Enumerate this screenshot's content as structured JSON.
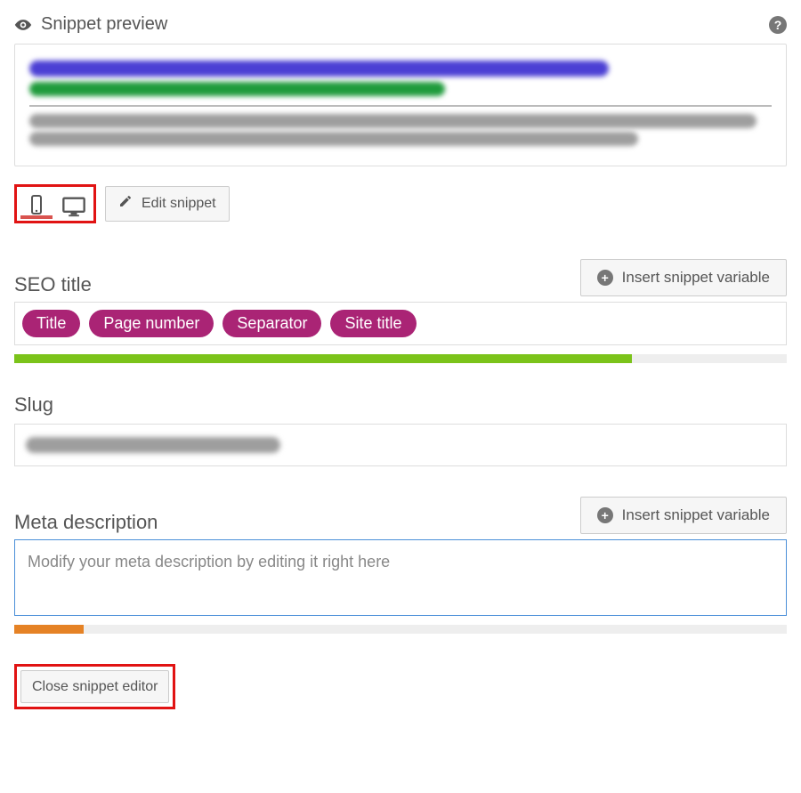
{
  "header": {
    "title": "Snippet preview"
  },
  "toolbar": {
    "edit_snippet_label": "Edit snippet",
    "close_label": "Close snippet editor",
    "insert_variable_label": "Insert snippet variable"
  },
  "seo_title": {
    "label": "SEO title",
    "tokens": [
      "Title",
      "Page number",
      "Separator",
      "Site title"
    ],
    "progress_percent": 80,
    "progress_color": "#7bc31a"
  },
  "slug": {
    "label": "Slug",
    "value": ""
  },
  "meta": {
    "label": "Meta description",
    "placeholder": "Modify your meta description by editing it right here",
    "progress_percent": 9,
    "progress_color": "#e58225"
  }
}
